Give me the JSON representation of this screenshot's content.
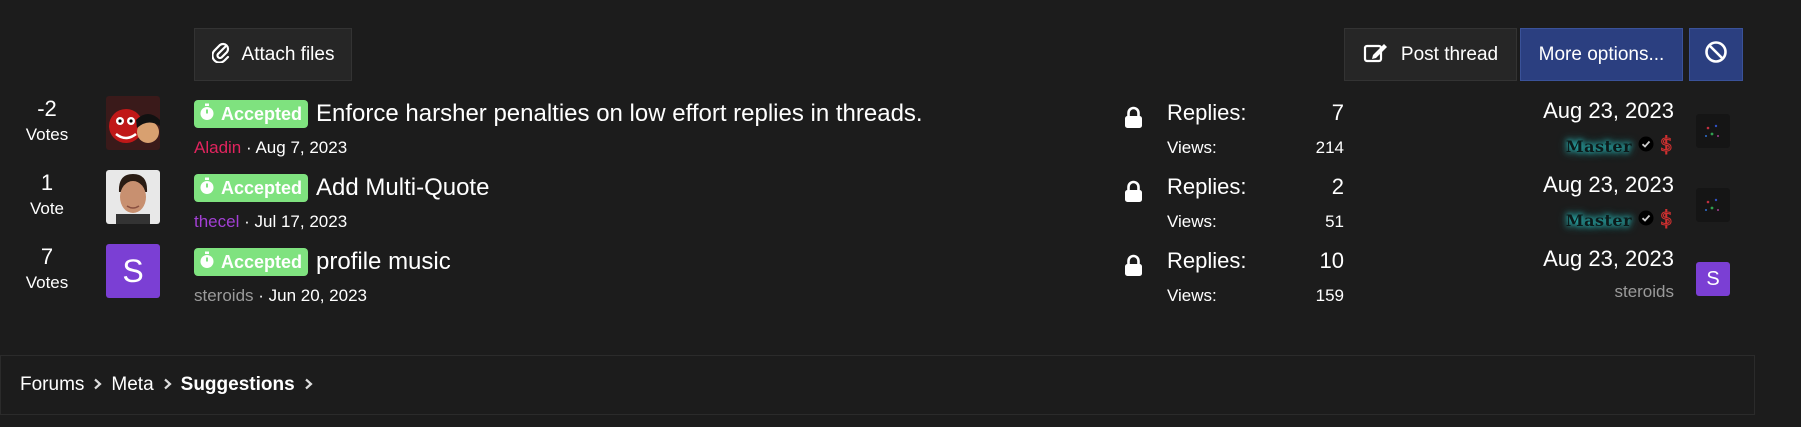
{
  "toolbar": {
    "attach_label": "Attach files",
    "post_label": "Post thread",
    "more_label": "More options..."
  },
  "threads": [
    {
      "votes": "-2",
      "votes_label": "Votes",
      "badge": "Accepted",
      "title": "Enforce harsher penalties on low effort replies in threads.",
      "author": "Aladin",
      "date": "Aug 7, 2023",
      "replies_label": "Replies:",
      "replies": "7",
      "views_label": "Views:",
      "views": "214",
      "last_date": "Aug 23, 2023",
      "last_user": "Master"
    },
    {
      "votes": "1",
      "votes_label": "Vote",
      "badge": "Accepted",
      "title": "Add Multi-Quote",
      "author": "thecel",
      "date": "Jul 17, 2023",
      "replies_label": "Replies:",
      "replies": "2",
      "views_label": "Views:",
      "views": "51",
      "last_date": "Aug 23, 2023",
      "last_user": "Master"
    },
    {
      "votes": "7",
      "votes_label": "Votes",
      "badge": "Accepted",
      "title": "profile music",
      "author": "steroids",
      "avatar_letter": "S",
      "date": "Jun 20, 2023",
      "replies_label": "Replies:",
      "replies": "10",
      "views_label": "Views:",
      "views": "159",
      "last_date": "Aug 23, 2023",
      "last_user": "steroids",
      "last_avatar_letter": "S"
    }
  ],
  "separator": "·",
  "breadcrumb": [
    "Forums",
    "Meta",
    "Suggestions"
  ],
  "colors": {
    "background": "#1c1c1c",
    "accent_button": "#2b3f80",
    "badge_green": "#7fe27f",
    "author_red": "#e0245e",
    "author_purple": "#a23fd4",
    "avatar_purple": "#7b3fd4"
  },
  "icons": {
    "attach": "paperclip-icon",
    "post": "edit-icon",
    "ignore": "ban-icon",
    "lock": "lock-icon",
    "badge": "stopwatch-icon",
    "verified": "check-badge-icon",
    "dollar": "dollar-icon",
    "chevron": "chevron-right-icon"
  }
}
